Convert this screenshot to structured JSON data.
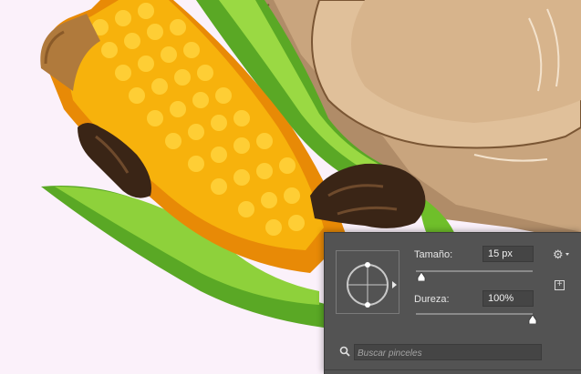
{
  "brush_panel": {
    "size_label": "Tamaño:",
    "size_value": "15 px",
    "hardness_label": "Dureza:",
    "hardness_value": "100%",
    "search_placeholder": "Buscar pinceles",
    "size_slider_level": 0.05,
    "hardness_slider_level": 1.0,
    "icons": [
      "brush-angle-preview-icon",
      "gear-icon",
      "new-preset-icon",
      "search-icon"
    ]
  },
  "colors": {
    "panel_bg": "#535353",
    "field_bg": "#454545",
    "canvas_bg": "#fbf1fa",
    "corn_yellow": "#f7b20c",
    "leaf_green": "#6fbf2a",
    "fur_brown": "#c9a57e"
  }
}
